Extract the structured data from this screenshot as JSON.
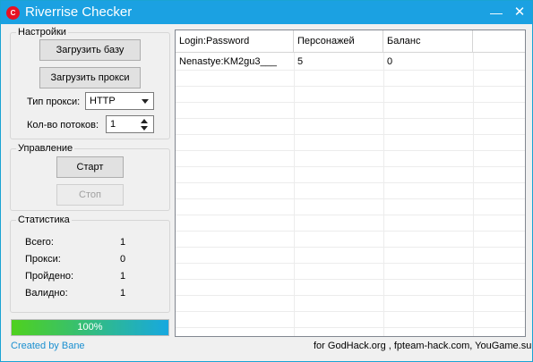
{
  "window": {
    "title": "Riverrise Checker",
    "icon_text": "C",
    "min_glyph": "—",
    "close_glyph": "✕"
  },
  "settings": {
    "legend": "Настройки",
    "load_base": "Загрузить базу",
    "load_proxy": "Загрузить прокси",
    "proxy_type_label": "Тип прокси:",
    "proxy_type_value": "HTTP",
    "threads_label": "Кол-во потоков:",
    "threads_value": "1"
  },
  "control": {
    "legend": "Управление",
    "start": "Старт",
    "stop": "Стоп"
  },
  "stats": {
    "legend": "Статистика",
    "rows": [
      {
        "label": "Всего:",
        "value": "1"
      },
      {
        "label": "Прокси:",
        "value": "0"
      },
      {
        "label": "Пройдено:",
        "value": "1"
      },
      {
        "label": "Валидно:",
        "value": "1"
      }
    ]
  },
  "progress": {
    "percent": 100,
    "text": "100%"
  },
  "table": {
    "columns": [
      "Login:Password",
      "Персонажей",
      "Баланс",
      ""
    ],
    "rows": [
      [
        "Nenastye:KM2gu3___",
        "5",
        "0",
        ""
      ]
    ]
  },
  "footer": {
    "credit": "Created by Bane",
    "sites": "for GodHack.org , fpteam-hack.com, YouGame.su"
  },
  "colors": {
    "titlebar": "#1ba1e2",
    "accent_link": "#1a8fd0",
    "progress_start": "#4fd11d",
    "progress_end": "#17a8e0"
  }
}
